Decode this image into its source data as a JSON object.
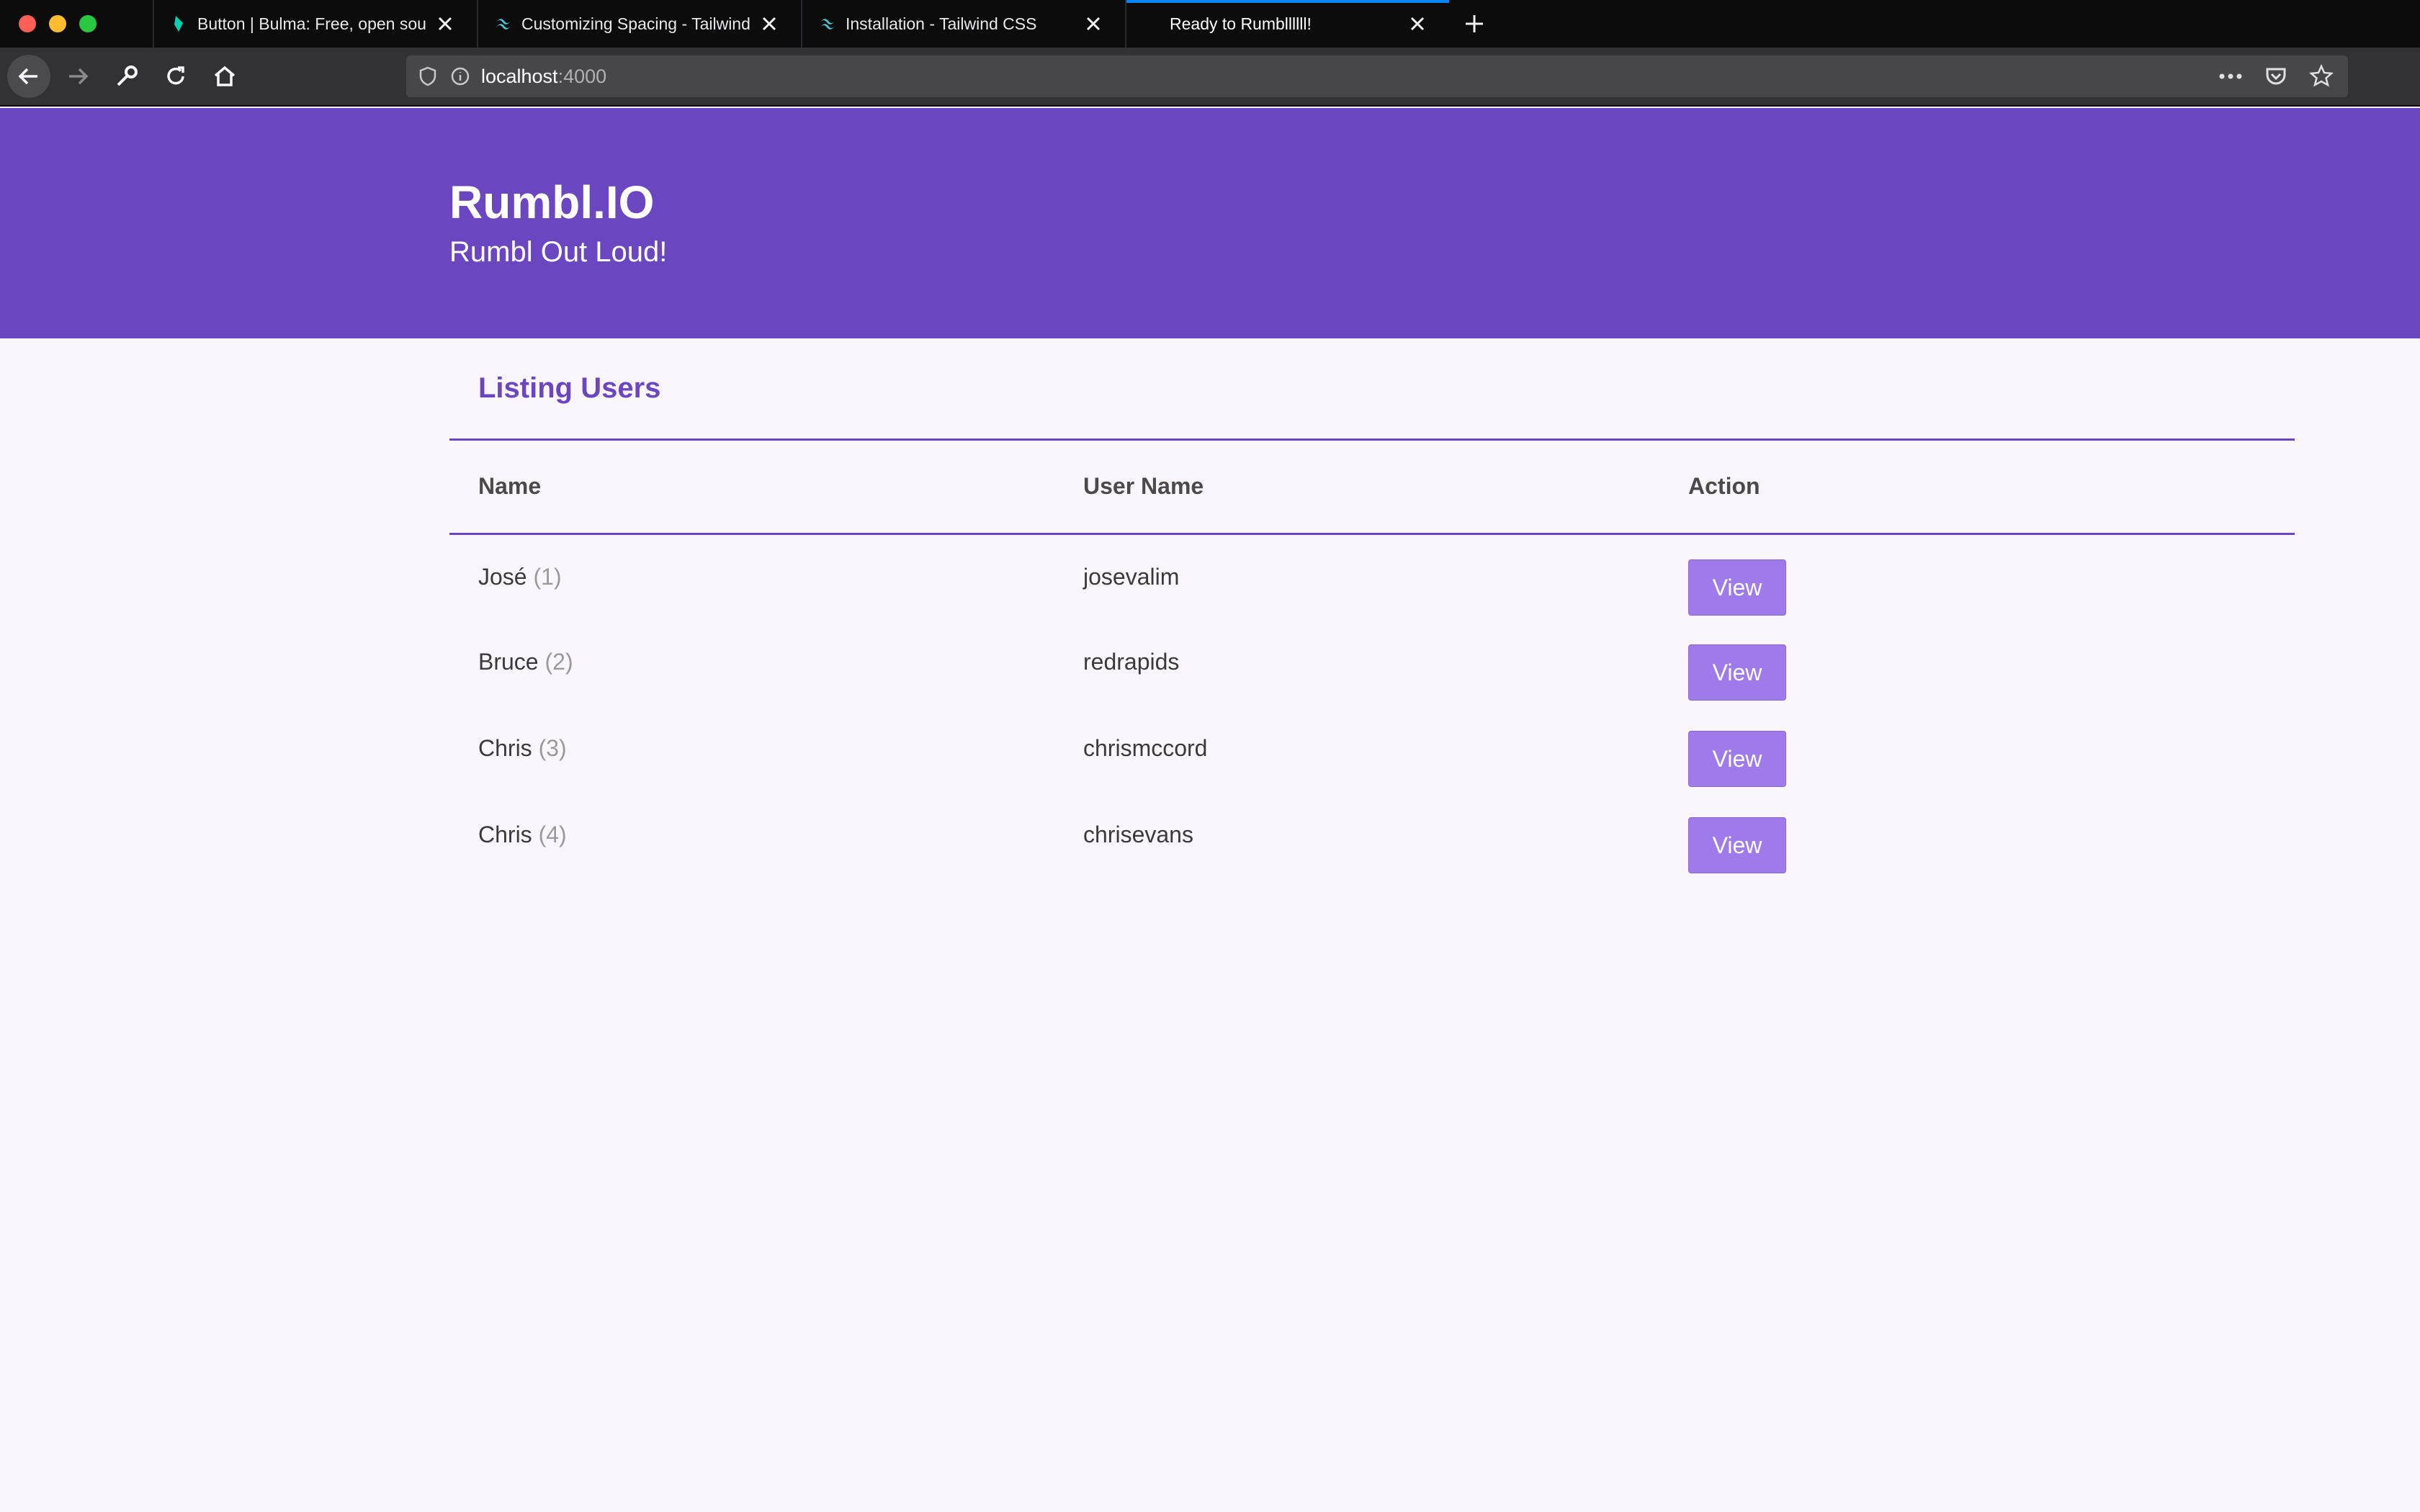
{
  "browser": {
    "tabs": [
      {
        "label": "Button | Bulma: Free, open source",
        "icon": "bulma-icon",
        "active": false
      },
      {
        "label": "Customizing Spacing - Tailwind CSS",
        "icon": "tailwind-icon",
        "active": false
      },
      {
        "label": "Installation - Tailwind CSS",
        "icon": "tailwind-icon",
        "active": false
      },
      {
        "label": "Ready to Rumbllllll!",
        "icon": "",
        "active": true
      }
    ],
    "url_host": "localhost",
    "url_port": ":4000"
  },
  "header": {
    "title": "Rumbl.IO",
    "subtitle": "Rumbl Out Loud!"
  },
  "main": {
    "heading": "Listing Users",
    "columns": [
      "Name",
      "User Name",
      "Action"
    ],
    "users": [
      {
        "name": "José",
        "id": "(1)",
        "username": "josevalim",
        "action": "View"
      },
      {
        "name": "Bruce",
        "id": "(2)",
        "username": "redrapids",
        "action": "View"
      },
      {
        "name": "Chris",
        "id": "(3)",
        "username": "chrismccord",
        "action": "View"
      },
      {
        "name": "Chris",
        "id": "(4)",
        "username": "chrisevans",
        "action": "View"
      }
    ]
  },
  "colors": {
    "brand": "#6b46c1",
    "button": "#9f7aea",
    "background": "#fbf6fe"
  }
}
